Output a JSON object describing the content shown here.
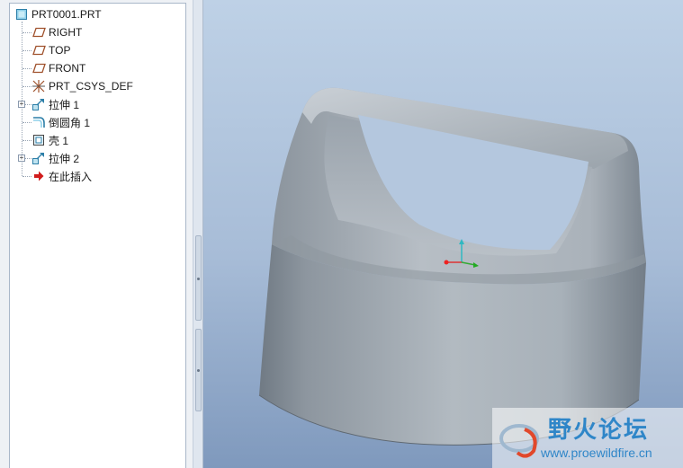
{
  "model_tree": {
    "root": {
      "label": "PRT0001.PRT",
      "icon": "part-icon"
    },
    "items": [
      {
        "label": "RIGHT",
        "icon": "datum-plane-icon",
        "expandable": false
      },
      {
        "label": "TOP",
        "icon": "datum-plane-icon",
        "expandable": false
      },
      {
        "label": "FRONT",
        "icon": "datum-plane-icon",
        "expandable": false
      },
      {
        "label": "PRT_CSYS_DEF",
        "icon": "csys-icon",
        "expandable": false
      },
      {
        "label": "拉伸 1",
        "icon": "extrude-icon",
        "expandable": true
      },
      {
        "label": "倒圆角 1",
        "icon": "round-icon",
        "expandable": false
      },
      {
        "label": "壳 1",
        "icon": "shell-icon",
        "expandable": false
      },
      {
        "label": "拉伸 2",
        "icon": "extrude-icon",
        "expandable": true
      },
      {
        "label": "在此插入",
        "icon": "insert-here-arrow-icon",
        "expandable": false
      }
    ]
  },
  "watermark": {
    "title": "野火论坛",
    "url": "www.proewildfire.cn"
  },
  "colors": {
    "model_body": "#a7b0b8",
    "background_top": "#bed1e6",
    "background_bottom": "#7f99bd",
    "watermark": "#2f86c8"
  }
}
